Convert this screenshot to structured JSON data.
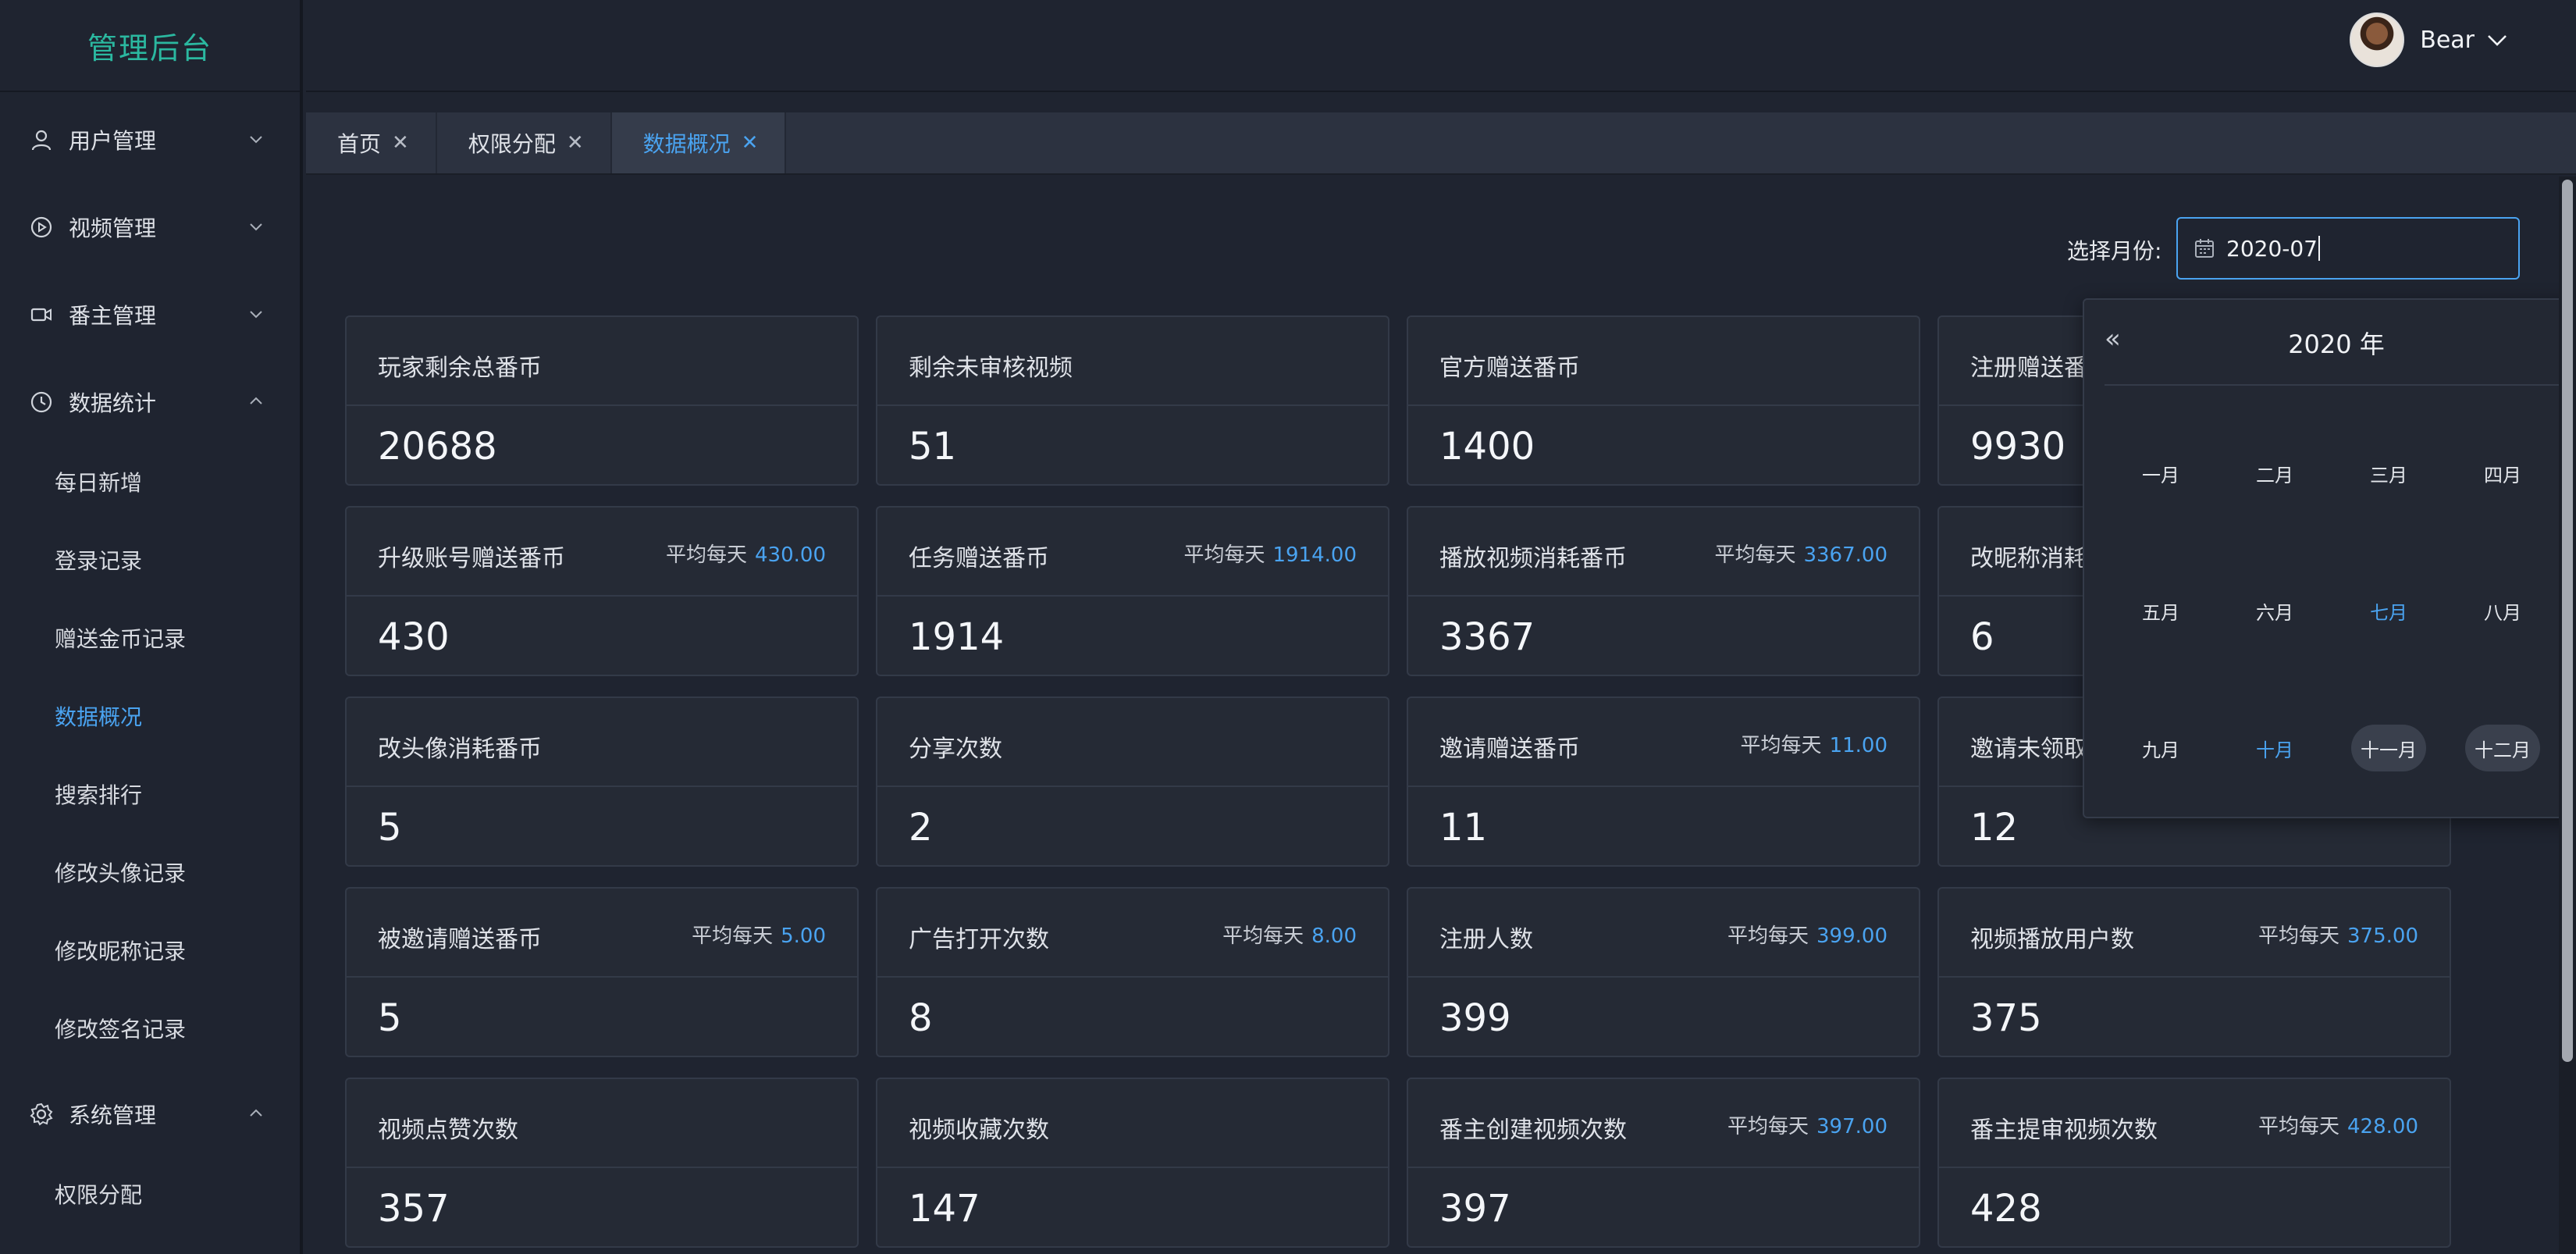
{
  "app": {
    "title": "管理后台"
  },
  "sidebar": {
    "groups": [
      {
        "label": "用户管理",
        "icon": "user-icon",
        "expanded": false
      },
      {
        "label": "视频管理",
        "icon": "play-circle-icon",
        "expanded": false
      },
      {
        "label": "番主管理",
        "icon": "video-camera-icon",
        "expanded": false
      },
      {
        "label": "数据统计",
        "icon": "clock-icon",
        "expanded": true
      },
      {
        "label": "系统管理",
        "icon": "gear-icon",
        "expanded": true
      }
    ],
    "stats_items": [
      "每日新增",
      "登录记录",
      "赠送金币记录",
      "数据概况",
      "搜索排行",
      "修改头像记录",
      "修改昵称记录",
      "修改签名记录"
    ],
    "system_items": [
      "权限分配"
    ],
    "active_item": "数据概况"
  },
  "header": {
    "user_name": "Bear"
  },
  "tabs": [
    {
      "label": "首页",
      "active": false
    },
    {
      "label": "权限分配",
      "active": false
    },
    {
      "label": "数据概况",
      "active": true
    }
  ],
  "filter": {
    "label": "选择月份:",
    "value": "2020-07"
  },
  "avg_label": "平均每天",
  "cards": [
    {
      "title": "玩家剩余总番币",
      "value": "20688",
      "avg": ""
    },
    {
      "title": "剩余未审核视频",
      "value": "51",
      "avg": ""
    },
    {
      "title": "官方赠送番币",
      "value": "1400",
      "avg": ""
    },
    {
      "title": "注册赠送番",
      "value": "9930",
      "avg": ""
    },
    {
      "title": "升级账号赠送番币",
      "value": "430",
      "avg": "430.00"
    },
    {
      "title": "任务赠送番币",
      "value": "1914",
      "avg": "1914.00"
    },
    {
      "title": "播放视频消耗番币",
      "value": "3367",
      "avg": "3367.00"
    },
    {
      "title": "改昵称消耗",
      "value": "6",
      "avg": ""
    },
    {
      "title": "改头像消耗番币",
      "value": "5",
      "avg": ""
    },
    {
      "title": "分享次数",
      "value": "2",
      "avg": ""
    },
    {
      "title": "邀请赠送番币",
      "value": "11",
      "avg": "11.00"
    },
    {
      "title": "邀请未领取",
      "value": "12",
      "avg": ""
    },
    {
      "title": "被邀请赠送番币",
      "value": "5",
      "avg": "5.00"
    },
    {
      "title": "广告打开次数",
      "value": "8",
      "avg": "8.00"
    },
    {
      "title": "注册人数",
      "value": "399",
      "avg": "399.00"
    },
    {
      "title": "视频播放用户数",
      "value": "375",
      "avg": "375.00"
    },
    {
      "title": "视频点赞次数",
      "value": "357",
      "avg": ""
    },
    {
      "title": "视频收藏次数",
      "value": "147",
      "avg": ""
    },
    {
      "title": "番主创建视频次数",
      "value": "397",
      "avg": "397.00"
    },
    {
      "title": "番主提审视频次数",
      "value": "428",
      "avg": "428.00"
    }
  ],
  "picker": {
    "prev_symbol": "«",
    "next_symbol": "»",
    "year": "2020 年",
    "months": [
      "一月",
      "二月",
      "三月",
      "四月",
      "五月",
      "六月",
      "七月",
      "八月",
      "九月",
      "十月",
      "十一月",
      "十二月"
    ],
    "selected": "七月",
    "today": "十月",
    "hovered": [
      "十一月",
      "十二月"
    ]
  },
  "colors": {
    "accent": "#4aa3f0",
    "brand": "#2bb8a0",
    "background": "#1f2430",
    "card": "#252a35"
  }
}
